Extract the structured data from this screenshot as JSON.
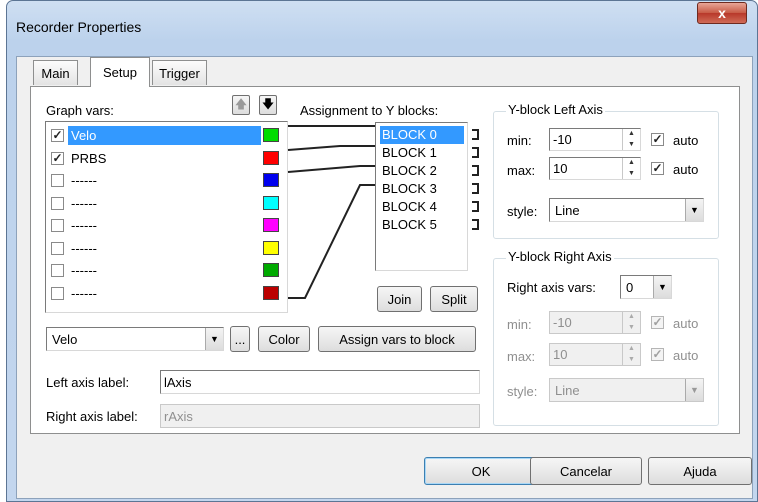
{
  "window": {
    "title": "Recorder Properties",
    "close_label": "x"
  },
  "tabs": [
    {
      "label": "Main",
      "active": false
    },
    {
      "label": "Setup",
      "active": true
    },
    {
      "label": "Trigger",
      "active": false
    }
  ],
  "graph_vars": {
    "label": "Graph vars:",
    "up_icon": "arrow-up-icon",
    "down_icon": "arrow-down-icon",
    "items": [
      {
        "name": "Velo",
        "checked": true,
        "selected": true,
        "color": "#00dd00"
      },
      {
        "name": "PRBS",
        "checked": true,
        "selected": false,
        "color": "#ff0000"
      },
      {
        "name": "------",
        "checked": false,
        "selected": false,
        "color": "#0000ee"
      },
      {
        "name": "------",
        "checked": false,
        "selected": false,
        "color": "#00ffff"
      },
      {
        "name": "------",
        "checked": false,
        "selected": false,
        "color": "#ff00ff"
      },
      {
        "name": "------",
        "checked": false,
        "selected": false,
        "color": "#ffff00"
      },
      {
        "name": "------",
        "checked": false,
        "selected": false,
        "color": "#00aa00"
      },
      {
        "name": "------",
        "checked": false,
        "selected": false,
        "color": "#bb0000"
      }
    ]
  },
  "assignment": {
    "label": "Assignment to Y blocks:",
    "blocks": [
      "BLOCK 0",
      "BLOCK 1",
      "BLOCK 2",
      "BLOCK 3",
      "BLOCK 4",
      "BLOCK 5"
    ],
    "selected_block": "BLOCK 0",
    "join_label": "Join",
    "split_label": "Split"
  },
  "var_select": {
    "value": "Velo"
  },
  "buttons": {
    "ellipsis": "...",
    "color": "Color",
    "assign": "Assign vars to block",
    "ok": "OK",
    "cancel": "Cancelar",
    "help": "Ajuda"
  },
  "axis_labels": {
    "left_label": "Left axis label:",
    "left_value": "lAxis",
    "right_label": "Right axis label:",
    "right_value": "rAxis"
  },
  "left_axis": {
    "title": "Y-block Left Axis",
    "min_label": "min:",
    "min_value": "-10",
    "max_label": "max:",
    "max_value": "10",
    "auto_label": "auto",
    "min_auto": true,
    "max_auto": true,
    "style_label": "style:",
    "style_value": "Line"
  },
  "right_axis": {
    "title": "Y-block Right Axis",
    "vars_label": "Right axis vars:",
    "vars_value": "0",
    "min_label": "min:",
    "min_value": "-10",
    "max_label": "max:",
    "max_value": "10",
    "auto_label": "auto",
    "style_label": "style:",
    "style_value": "Line"
  }
}
